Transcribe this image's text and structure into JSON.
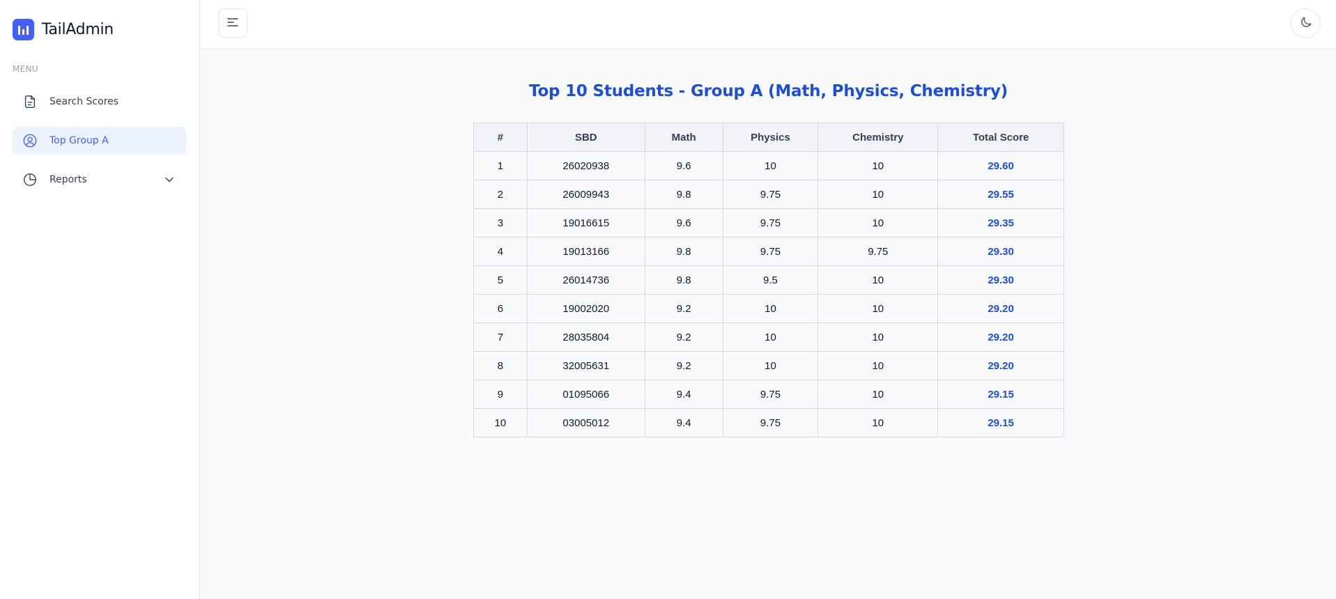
{
  "brand": {
    "name": "TailAdmin"
  },
  "sidebar": {
    "menu_label": "MENU",
    "items": [
      {
        "label": "Search Scores",
        "icon": "document-icon"
      },
      {
        "label": "Top Group A",
        "icon": "user-circle-icon",
        "active": true
      },
      {
        "label": "Reports",
        "icon": "pie-chart-icon",
        "expandable": true
      }
    ]
  },
  "header": {
    "menu_toggle_icon": "hamburger-icon",
    "theme_icon": "moon-icon"
  },
  "main": {
    "title": "Top 10 Students - Group A (Math, Physics, Chemistry)",
    "table": {
      "columns": [
        "#",
        "SBD",
        "Math",
        "Physics",
        "Chemistry",
        "Total Score"
      ],
      "rows": [
        [
          "1",
          "26020938",
          "9.6",
          "10",
          "10",
          "29.60"
        ],
        [
          "2",
          "26009943",
          "9.8",
          "9.75",
          "10",
          "29.55"
        ],
        [
          "3",
          "19016615",
          "9.6",
          "9.75",
          "10",
          "29.35"
        ],
        [
          "4",
          "19013166",
          "9.8",
          "9.75",
          "9.75",
          "29.30"
        ],
        [
          "5",
          "26014736",
          "9.8",
          "9.5",
          "10",
          "29.30"
        ],
        [
          "6",
          "19002020",
          "9.2",
          "10",
          "10",
          "29.20"
        ],
        [
          "7",
          "28035804",
          "9.2",
          "10",
          "10",
          "29.20"
        ],
        [
          "8",
          "32005631",
          "9.2",
          "10",
          "10",
          "29.20"
        ],
        [
          "9",
          "01095066",
          "9.4",
          "9.75",
          "10",
          "29.15"
        ],
        [
          "10",
          "03005012",
          "9.4",
          "9.75",
          "10",
          "29.15"
        ]
      ]
    }
  },
  "colors": {
    "accent": "#465fff",
    "title": "#1d4ed8",
    "active_bg": "#ecf3ff"
  }
}
